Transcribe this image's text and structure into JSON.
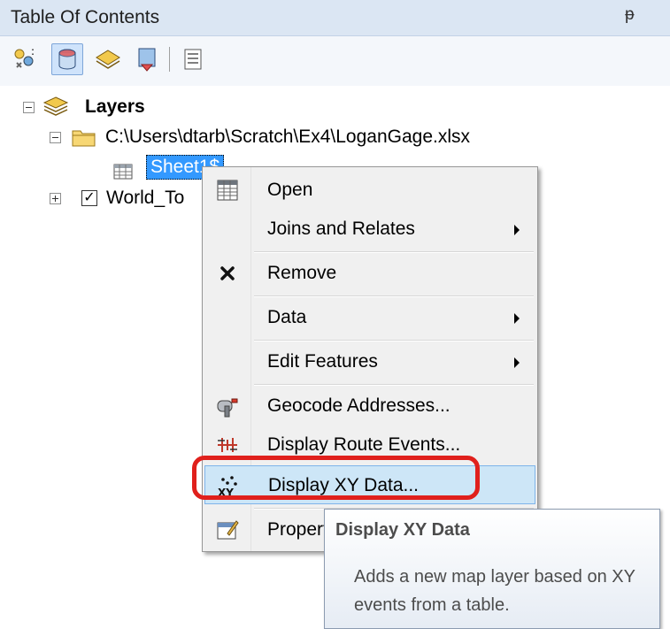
{
  "window": {
    "title": "Table Of Contents",
    "pin_glyph": "ᵽ"
  },
  "toolbar": {
    "buttons": [
      {
        "name": "list-by-drawing-order-icon"
      },
      {
        "name": "list-by-source-icon",
        "active": true
      },
      {
        "name": "list-by-visibility-icon"
      },
      {
        "name": "list-by-selection-icon"
      },
      {
        "name": "options-icon"
      }
    ]
  },
  "tree": {
    "root_label": "Layers",
    "source_label": "C:\\Users\\dtarb\\Scratch\\Ex4\\LoganGage.xlsx",
    "table_label": "Sheet1$",
    "layer_label": "World_To",
    "layer_checked": true
  },
  "context_menu": {
    "items": [
      {
        "label": "Open",
        "icon": "table-icon",
        "submenu": false
      },
      {
        "label": "Joins and Relates",
        "icon": "",
        "submenu": true
      },
      {
        "label": "Remove",
        "icon": "remove-x-icon",
        "submenu": false
      },
      {
        "label": "Data",
        "icon": "",
        "submenu": true
      },
      {
        "label": "Edit Features",
        "icon": "",
        "submenu": true
      },
      {
        "label": "Geocode Addresses...",
        "icon": "geocode-icon",
        "submenu": false
      },
      {
        "label": "Display Route Events...",
        "icon": "route-events-icon",
        "submenu": false
      },
      {
        "label": "Display XY Data...",
        "icon": "xy-data-icon",
        "submenu": false,
        "highlighted": true
      },
      {
        "label": "Properties...",
        "icon": "properties-icon",
        "submenu": false
      }
    ]
  },
  "tooltip": {
    "title": "Display XY Data",
    "body": "Adds a new map layer based on XY events from a table."
  },
  "colors": {
    "highlight": "#cde6f7",
    "annotation_red": "#e0201c",
    "selection_blue": "#3399ff"
  }
}
